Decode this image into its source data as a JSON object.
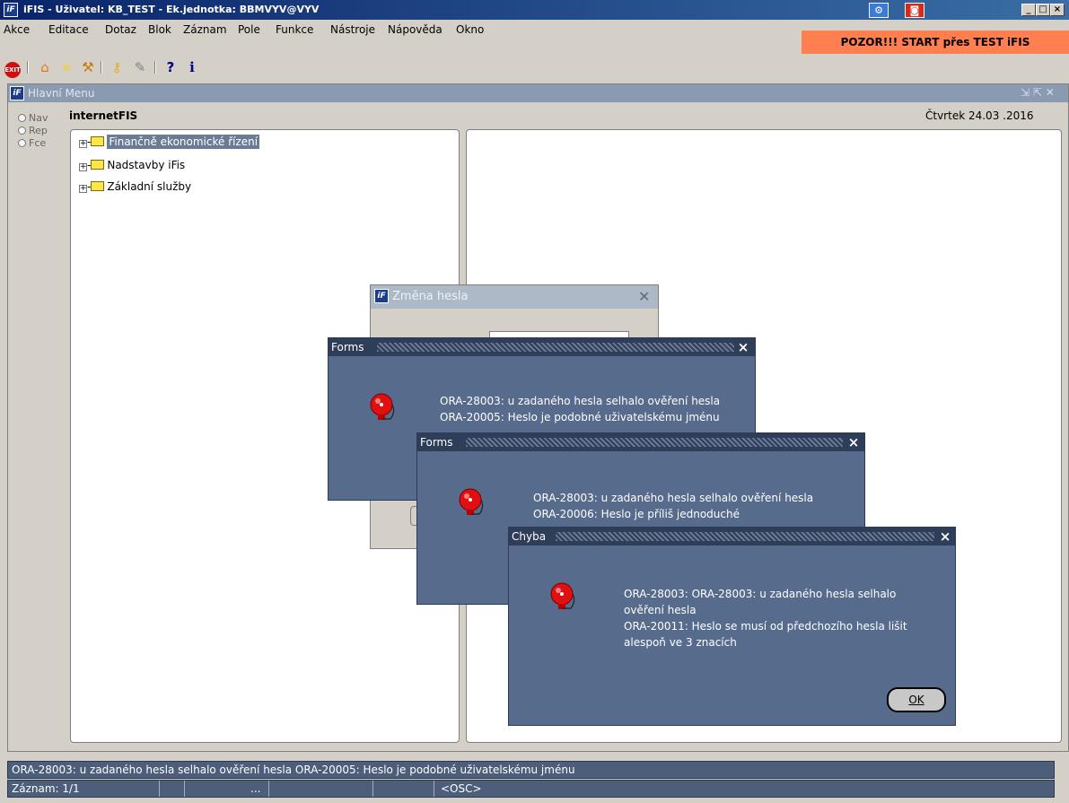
{
  "window": {
    "title": "iFIS - Uživatel: KB_TEST - Ek.jednotka: BBMVYV@VYV",
    "app_icon": "iF"
  },
  "menu": {
    "items": [
      "Akce",
      "Editace",
      "Dotaz",
      "Blok",
      "Záznam",
      "Pole",
      "Funkce",
      "Nástroje",
      "Nápověda",
      "Okno"
    ]
  },
  "warning_banner": "POZOR!!!  START přes TEST iFIS",
  "toolbar": {
    "icons": [
      "exit-icon",
      "home-icon",
      "star-icon",
      "tree-icon",
      "key-icon",
      "wrench-icon",
      "help-icon",
      "info-icon"
    ],
    "exit_label": "EXIT",
    "help_label": "?",
    "info_label": "i"
  },
  "main_window": {
    "title": "Hlavní Menu",
    "app_name": "internetFIS",
    "date": "Čtvrtek 24.03 .2016",
    "radios": [
      "Nav",
      "Rep",
      "Fce"
    ],
    "tree": [
      "Finančně ekonomické řízení",
      "Nadstavby iFis",
      "Základní služby"
    ]
  },
  "password_dialog": {
    "title": "Změna hesla"
  },
  "dialogs": [
    {
      "title": "Forms",
      "lines": [
        "ORA-28003: u zadaného hesla selhalo ověření hesla",
        "ORA-20005: Heslo je podobné uživatelskému jménu"
      ]
    },
    {
      "title": "Forms",
      "lines": [
        "ORA-28003: u zadaného hesla selhalo ověření hesla",
        "ORA-20006: Heslo je příliš jednoduché"
      ]
    },
    {
      "title": "Chyba",
      "lines": [
        "ORA-28003: ORA-28003: u zadaného hesla selhalo",
        "ověření hesla",
        "ORA-20011: Heslo se musí od předchozího hesla lišit",
        "alespoň ve 3 znacích"
      ],
      "ok_label": "OK"
    }
  ],
  "status": {
    "message": "ORA-28003: u zadaného hesla selhalo ověření hesla ORA-20005: Heslo je podobné uživatelskému jménu",
    "record": "Záznam: 1/1",
    "ellipsis": "...",
    "mode": "<OSC>"
  }
}
